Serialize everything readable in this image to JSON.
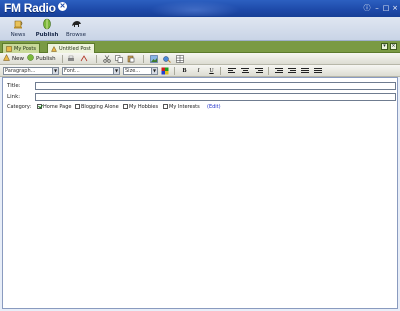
{
  "app": {
    "title": "FM Radio"
  },
  "window_controls": {
    "info_icon": "info-icon",
    "min_label": "–",
    "max_label": "□",
    "close_label": "×"
  },
  "nav": [
    {
      "label": "News",
      "icon": "news-icon"
    },
    {
      "label": "Publish",
      "icon": "publish-icon",
      "active": true
    },
    {
      "label": "Browse",
      "icon": "browse-icon"
    }
  ],
  "tabs": [
    {
      "label": "My Posts",
      "icon": "posts-icon"
    },
    {
      "label": "Untitled Post",
      "icon": "post-icon",
      "active": true
    }
  ],
  "toolbar": {
    "new_label": "New",
    "publish_label": "Publish"
  },
  "format": {
    "paragraph": "Paragraph...",
    "font": "Font...",
    "size": "Size...",
    "bold": "B",
    "italic": "I",
    "underline": "U"
  },
  "post": {
    "title_label": "Title:",
    "title_value": "",
    "link_label": "Link:",
    "link_value": "",
    "category_label": "Category:",
    "categories": [
      {
        "label": "Home Page",
        "checked": true
      },
      {
        "label": "Blogging Alone",
        "checked": false
      },
      {
        "label": "My Hobbies",
        "checked": false
      },
      {
        "label": "My Interests",
        "checked": false
      }
    ],
    "edit_label": "(Edit)"
  },
  "colors": {
    "titlebar": "#1d49a8",
    "tabstrip": "#7a9a44",
    "link": "#2233cc"
  }
}
